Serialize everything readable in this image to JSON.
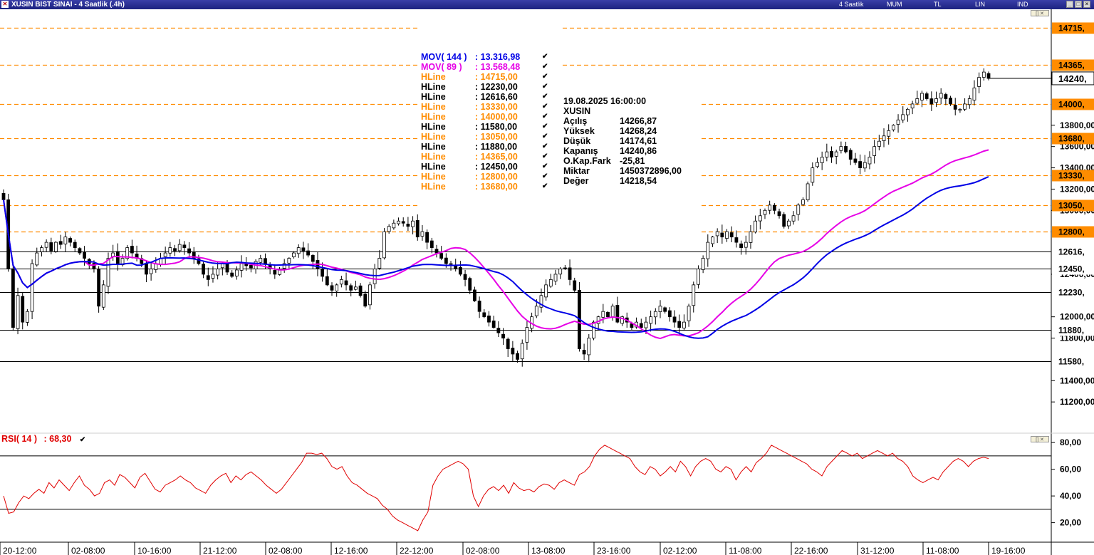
{
  "window": {
    "title": "XUSIN BIST SINAI - 4 Saatlik (.4h)",
    "period": "4 Saatlik",
    "chart_style": "MUM",
    "currency": "TL",
    "scale": "LIN",
    "indicator": "IND"
  },
  "legend": {
    "mov144": {
      "name": "MOV( 144 )",
      "value": ": 13.316,98",
      "color": "#0000e6"
    },
    "mov89": {
      "name": "MOV( 89 )",
      "value": ": 13.568,48",
      "color": "#e600e6"
    },
    "hlines": [
      {
        "name": "HLine",
        "value": ": 14715,00",
        "color": "#ff8c00"
      },
      {
        "name": "HLine",
        "value": ": 12230,00",
        "color": "#000000"
      },
      {
        "name": "HLine",
        "value": ": 12616,60",
        "color": "#000000"
      },
      {
        "name": "HLine",
        "value": ": 13330,00",
        "color": "#ff8c00"
      },
      {
        "name": "HLine",
        "value": ": 14000,00",
        "color": "#ff8c00"
      },
      {
        "name": "HLine",
        "value": ": 11580,00",
        "color": "#000000"
      },
      {
        "name": "HLine",
        "value": ": 13050,00",
        "color": "#ff8c00"
      },
      {
        "name": "HLine",
        "value": ": 11880,00",
        "color": "#000000"
      },
      {
        "name": "HLine",
        "value": ": 14365,00",
        "color": "#ff8c00"
      },
      {
        "name": "HLine",
        "value": ": 12450,00",
        "color": "#000000"
      },
      {
        "name": "HLine",
        "value": ": 12800,00",
        "color": "#ff8c00"
      },
      {
        "name": "HLine",
        "value": ": 13680,00",
        "color": "#ff8c00"
      }
    ]
  },
  "info": {
    "datetime": "19.08.2025  16:00:00",
    "symbol": "XUSIN",
    "rows": [
      {
        "k": "Açılış",
        "v": "14266,87"
      },
      {
        "k": "Yüksek",
        "v": "14268,24"
      },
      {
        "k": "Düşük",
        "v": "14174,61"
      },
      {
        "k": "Kapanış",
        "v": "14240,86"
      },
      {
        "k": "O.Kap.Fark",
        "v": "-25,81"
      },
      {
        "k": "Miktar",
        "v": "1450372896,00"
      },
      {
        "k": "Değer",
        "v": "14218,54"
      }
    ]
  },
  "rsi_legend": {
    "name": "RSI( 14 )",
    "value": ": 68,30"
  },
  "colors": {
    "orange": "#ff8c00",
    "mov144": "#0000e6",
    "mov89": "#e600e6",
    "rsi": "#e00000",
    "tag_bg": "#ff8c00"
  },
  "chart_data": [
    {
      "type": "candlestick",
      "title": "XUSIN BIST SINAI - 4 Saatlik (.4h)",
      "ylim": [
        10940,
        14890
      ],
      "y_ticks": [
        "13800,00",
        "13600,00",
        "13400,00",
        "13200,00",
        "13000,00",
        "12400,00",
        "12000,00",
        "11800,00",
        "11400,00",
        "11200,00"
      ],
      "y_tick_values": [
        13800,
        13600,
        13400,
        13200,
        13000,
        12400,
        12000,
        11800,
        11400,
        11200
      ],
      "x_ticks": [
        "20-12:00",
        "02-08:00",
        "10-16:00",
        "21-12:00",
        "02-08:00",
        "12-16:00",
        "22-12:00",
        "02-08:00",
        "13-08:00",
        "23-16:00",
        "02-12:00",
        "11-08:00",
        "22-16:00",
        "31-12:00",
        "11-08:00",
        "19-16:00"
      ],
      "hlines": [
        {
          "value": 14715,
          "label": "14715,",
          "style": "dashed",
          "color": "#ff8c00"
        },
        {
          "value": 14365,
          "label": "14365,",
          "style": "dashed",
          "color": "#ff8c00"
        },
        {
          "value": 14000,
          "label": "14000,",
          "style": "dashed",
          "color": "#ff8c00"
        },
        {
          "value": 13680,
          "label": "13680,",
          "style": "dashed",
          "color": "#ff8c00"
        },
        {
          "value": 13330,
          "label": "13330,",
          "style": "dashed",
          "color": "#ff8c00"
        },
        {
          "value": 13050,
          "label": "13050,",
          "style": "dashed",
          "color": "#ff8c00"
        },
        {
          "value": 12800,
          "label": "12800,",
          "style": "dashed",
          "color": "#ff8c00"
        },
        {
          "value": 12616.6,
          "label": "12616,",
          "style": "solid",
          "color": "#000000"
        },
        {
          "value": 12450,
          "label": "12450,",
          "style": "solid",
          "color": "#000000"
        },
        {
          "value": 12230,
          "label": "12230,",
          "style": "solid",
          "color": "#000000"
        },
        {
          "value": 11880,
          "label": "11880,",
          "style": "solid",
          "color": "#000000"
        },
        {
          "value": 11580,
          "label": "11580,",
          "style": "solid",
          "color": "#000000"
        }
      ],
      "last_price": {
        "value": 14240.86,
        "label": "14240,"
      },
      "candles_close": [
        13100,
        12450,
        11900,
        12200,
        11950,
        12050,
        12500,
        12600,
        12650,
        12700,
        12620,
        12700,
        12680,
        12750,
        12700,
        12650,
        12600,
        12550,
        12500,
        12450,
        12100,
        12300,
        12550,
        12600,
        12500,
        12550,
        12650,
        12600,
        12550,
        12500,
        12400,
        12450,
        12500,
        12550,
        12600,
        12650,
        12620,
        12680,
        12650,
        12600,
        12550,
        12500,
        12400,
        12350,
        12400,
        12450,
        12500,
        12420,
        12380,
        12440,
        12500,
        12480,
        12460,
        12520,
        12550,
        12500,
        12450,
        12400,
        12450,
        12500,
        12550,
        12600,
        12650,
        12620,
        12580,
        12520,
        12450,
        12380,
        12300,
        12250,
        12300,
        12350,
        12300,
        12250,
        12280,
        12200,
        12100,
        12300,
        12450,
        12550,
        12800,
        12850,
        12880,
        12900,
        12880,
        12850,
        12900,
        12750,
        12800,
        12700,
        12650,
        12600,
        12550,
        12500,
        12500,
        12450,
        12400,
        12350,
        12250,
        12150,
        12050,
        12000,
        11950,
        11900,
        11850,
        11800,
        11700,
        11650,
        11600,
        11750,
        11900,
        12000,
        12100,
        12200,
        12300,
        12350,
        12400,
        12450,
        12450,
        12350,
        12250,
        11700,
        11650,
        11800,
        11950,
        12000,
        12050,
        12000,
        12100,
        11950,
        12000,
        11950,
        11900,
        11950,
        11900,
        11950,
        12000,
        12050,
        12100,
        12050,
        12000,
        11950,
        11900,
        11950,
        12100,
        12300,
        12450,
        12550,
        12700,
        12750,
        12800,
        12750,
        12800,
        12750,
        12700,
        12650,
        12700,
        12800,
        12900,
        12950,
        13000,
        13050,
        13000,
        12950,
        12850,
        12900,
        12950,
        13050,
        13100,
        13250,
        13400,
        13450,
        13500,
        13550,
        13500,
        13550,
        13600,
        13550,
        13480,
        13450,
        13400,
        13450,
        13500,
        13600,
        13650,
        13700,
        13750,
        13800,
        13850,
        13900,
        13950,
        14000,
        14050,
        14100,
        14050,
        14000,
        14050,
        14100,
        14050,
        14000,
        13950,
        13950,
        14000,
        14050,
        14150,
        14250,
        14300,
        14240
      ]
    },
    {
      "type": "line",
      "series": [
        {
          "name": "MOV( 144 )",
          "last": 13316.98
        },
        {
          "name": "MOV( 89 )",
          "last": 13568.48
        }
      ]
    },
    {
      "type": "line",
      "series": [
        {
          "name": "RSI( 14 )",
          "last": 68.3
        }
      ],
      "ylim": [
        7,
        87
      ],
      "y_ticks": [
        "80,00",
        "60,00",
        "40,00",
        "20,00"
      ],
      "y_tick_values": [
        80,
        60,
        40,
        20
      ],
      "hlines": [
        70,
        30
      ],
      "values": [
        40,
        27,
        28,
        35,
        40,
        38,
        42,
        45,
        42,
        50,
        46,
        52,
        48,
        44,
        50,
        55,
        48,
        45,
        40,
        42,
        50,
        52,
        48,
        56,
        54,
        50,
        46,
        54,
        57,
        51,
        45,
        43,
        48,
        50,
        52,
        55,
        52,
        50,
        46,
        44,
        42,
        48,
        52,
        55,
        57,
        50,
        55,
        52,
        56,
        58,
        55,
        52,
        48,
        45,
        42,
        45,
        50,
        55,
        60,
        65,
        72,
        72,
        71,
        72,
        68,
        62,
        60,
        62,
        55,
        50,
        48,
        45,
        42,
        40,
        38,
        33,
        30,
        25,
        22,
        20,
        18,
        16,
        14,
        22,
        28,
        48,
        55,
        60,
        62,
        64,
        66,
        64,
        60,
        40,
        32,
        40,
        45,
        47,
        44,
        48,
        42,
        50,
        46,
        44,
        45,
        43,
        47,
        49,
        48,
        45,
        50,
        52,
        50,
        48,
        56,
        58,
        62,
        70,
        75,
        78,
        76,
        74,
        72,
        70,
        68,
        62,
        58,
        56,
        62,
        60,
        55,
        58,
        62,
        58,
        66,
        62,
        55,
        62,
        66,
        68,
        66,
        60,
        58,
        62,
        60,
        52,
        58,
        62,
        58,
        65,
        68,
        72,
        78,
        76,
        74,
        72,
        70,
        68,
        66,
        64,
        60,
        58,
        55,
        62,
        66,
        70,
        74,
        72,
        70,
        72,
        68,
        70,
        72,
        74,
        72,
        70,
        72,
        68,
        66,
        62,
        55,
        52,
        50,
        52,
        54,
        52,
        58,
        62,
        66,
        68,
        66,
        62,
        66,
        68,
        69,
        68
      ]
    }
  ]
}
